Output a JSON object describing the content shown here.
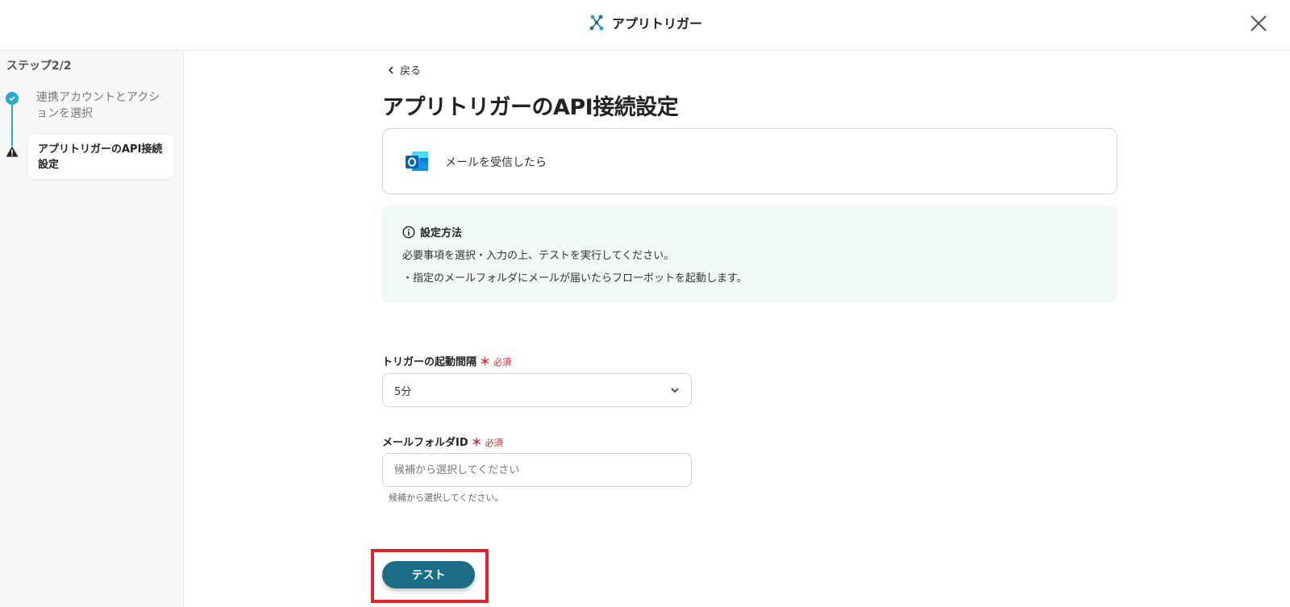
{
  "header": {
    "title": "アプリトリガー"
  },
  "sidebar": {
    "step_label": "ステップ2/2",
    "steps": [
      {
        "label": "連携アカウントとアクションを選択",
        "status": "complete"
      },
      {
        "label": "アプリトリガーのAPI接続設定",
        "status": "warning"
      }
    ]
  },
  "main": {
    "back_label": "戻る",
    "page_title": "アプリトリガーのAPI接続設定",
    "trigger": {
      "app_icon": "outlook-icon",
      "name": "メールを受信したら"
    },
    "info": {
      "title": "設定方法",
      "line1": "必要事項を選択・入力の上、テストを実行してください。",
      "line2": "・指定のメールフォルダにメールが届いたらフローボットを起動します。"
    },
    "fields": {
      "interval": {
        "label": "トリガーの起動間隔",
        "required_mark": "＊",
        "required_text": "必須",
        "value": "5分"
      },
      "folder": {
        "label": "メールフォルダID",
        "required_mark": "＊",
        "required_text": "必須",
        "placeholder": "候補から選択してください",
        "help": "候補から選択してください。"
      }
    },
    "test_button": "テスト"
  },
  "colors": {
    "accent": "#29a9c8",
    "button": "#1a6d85",
    "required": "#e0242b",
    "info_bg": "#f0f9f8"
  }
}
